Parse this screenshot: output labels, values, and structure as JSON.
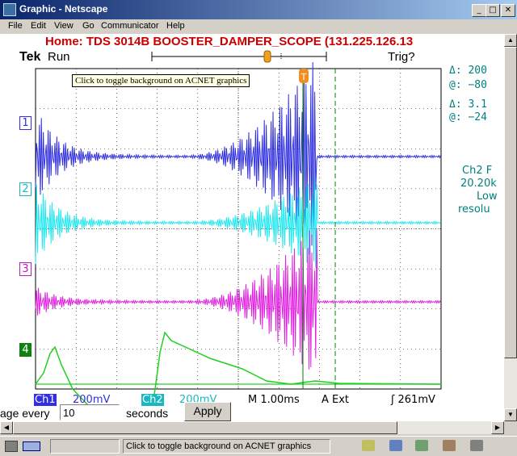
{
  "window": {
    "title": "Graphic - Netscape"
  },
  "menu": [
    "File",
    "Edit",
    "View",
    "Go",
    "Communicator",
    "Help"
  ],
  "scope": {
    "title": "Home:  TDS 3014B  BOOSTER_DAMPER_SCOPE  (131.225.126.13",
    "brand": "Tek",
    "state": "Run",
    "trigger_label": "Trig?",
    "tooltip": "Click to toggle background on ACNET graphics",
    "cursor1": {
      "delta": "Δ:   200",
      "at": "@:  −80"
    },
    "cursor2": {
      "delta": "Δ:  3.1",
      "at": "@:  −24"
    },
    "info_lines": [
      "Ch2 F",
      "20.20k",
      "Low",
      "resolu"
    ],
    "channel_labels": [
      "1",
      "2",
      "3",
      "4"
    ],
    "channel_colors": [
      "#3030e0",
      "#20e8f0",
      "#e020e0",
      "#20d020"
    ],
    "bottom": {
      "ch1": "Ch1",
      "ch1_scale": "200mV",
      "ch2": "Ch2",
      "ch2_scale": "200mV",
      "timebase": "M 1.00ms",
      "trigger_src": "A  Ext",
      "trigger_level": "ʃ  261mV"
    }
  },
  "refresh": {
    "prefix": "age every",
    "value": "10",
    "suffix": "seconds",
    "apply_label": "Apply"
  },
  "status": {
    "text": "Click to toggle background on ACNET graphics"
  }
}
